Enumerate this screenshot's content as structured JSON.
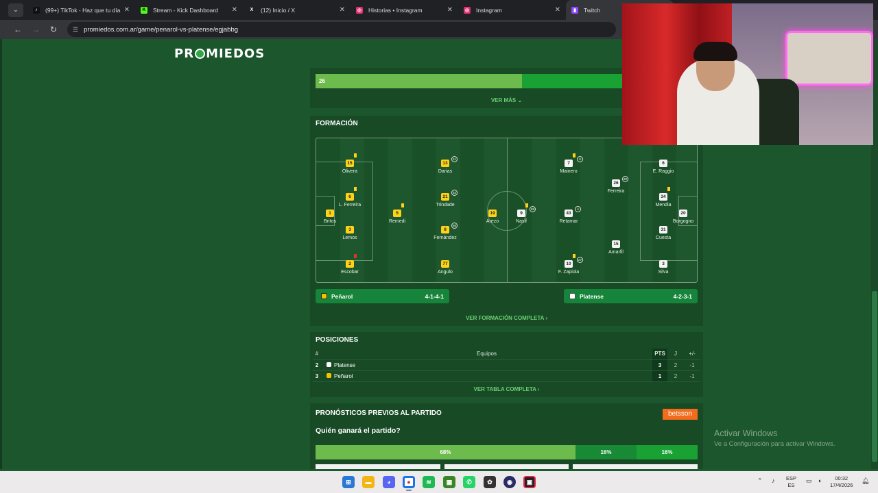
{
  "browser": {
    "tabs": [
      {
        "label": "(99+) TikTok - Haz que tu día sea",
        "icon": "tiktok-icon",
        "color": "#111111"
      },
      {
        "label": "Stream - Kick Dashboard",
        "icon": "kick-icon",
        "color": "#53fc18"
      },
      {
        "label": "(12) Inicio / X",
        "icon": "x-icon",
        "color": "#000000"
      },
      {
        "label": "Historias • Instagram",
        "icon": "instagram-icon",
        "color": "#e1306c"
      },
      {
        "label": "Instagram",
        "icon": "instagram-icon",
        "color": "#e1306c"
      },
      {
        "label": "Twitch",
        "icon": "twitch-icon",
        "color": "#9146ff"
      }
    ],
    "url": "promiedos.com.ar/game/penarol-vs-platense/egjabbg"
  },
  "site": {
    "logo_left": "PR",
    "logo_right": "MIEDOS"
  },
  "stats": {
    "bar_value": "26",
    "bar_fraction": 0.54,
    "ver_mas": "VER MÁS ⌄"
  },
  "formacion": {
    "title": "FORMACIÓN",
    "players": [
      {
        "num": "15",
        "name": "Olivera",
        "team": "home",
        "x": "",
        "card": "yellow"
      },
      {
        "num": "6",
        "name": "L. Ferreira",
        "team": "home",
        "card": "yellow"
      },
      {
        "num": "1",
        "name": "Britos",
        "team": "home"
      },
      {
        "num": "3",
        "name": "Lemos",
        "team": "home"
      },
      {
        "num": "2",
        "name": "Escobar",
        "team": "home",
        "card": "red"
      },
      {
        "num": "5",
        "name": "Remedi",
        "team": "home",
        "card": "yellow"
      },
      {
        "num": "13",
        "name": "Darias",
        "team": "home",
        "sub": "11"
      },
      {
        "num": "21",
        "name": "Trindade",
        "team": "home",
        "sub": "32"
      },
      {
        "num": "8",
        "name": "Fernández",
        "team": "home",
        "sub": "88"
      },
      {
        "num": "77",
        "name": "Angulo",
        "team": "home"
      },
      {
        "num": "19",
        "name": "Arezo",
        "team": "home"
      },
      {
        "num": "9",
        "name": "Nasif",
        "team": "away",
        "card": "yellow",
        "sub": "99"
      },
      {
        "num": "7",
        "name": "Mainero",
        "team": "away",
        "card": "yellow",
        "sub": "8"
      },
      {
        "num": "43",
        "name": "Retamar",
        "team": "away",
        "sub": "4"
      },
      {
        "num": "10",
        "name": "F. Zapiola",
        "team": "away",
        "card": "yellow",
        "sub": "27"
      },
      {
        "num": "26",
        "name": "Ferreira",
        "team": "away",
        "sub": "38"
      },
      {
        "num": "15",
        "name": "Amarfil",
        "team": "away"
      },
      {
        "num": "6",
        "name": "E. Raggio",
        "team": "away"
      },
      {
        "num": "34",
        "name": "Mendia",
        "team": "away",
        "card": "yellow"
      },
      {
        "num": "20",
        "name": "Borgogno",
        "team": "away"
      },
      {
        "num": "31",
        "name": "Cuesta",
        "team": "away"
      },
      {
        "num": "3",
        "name": "Silva",
        "team": "away"
      }
    ],
    "home": {
      "name": "Peñarol",
      "formation": "4-1-4-1"
    },
    "away": {
      "name": "Platense",
      "formation": "4-2-3-1"
    },
    "link": "VER FORMACIÓN COMPLETA ›"
  },
  "posiciones": {
    "title": "POSICIONES",
    "headers": {
      "pos": "#",
      "team": "Equipos",
      "pts": "PTS",
      "j": "J",
      "diff": "+/-"
    },
    "rows": [
      {
        "pos": "2",
        "team": "Platense",
        "pts": "3",
        "j": "2",
        "diff": "-1"
      },
      {
        "pos": "3",
        "team": "Peñarol",
        "pts": "1",
        "j": "2",
        "diff": "-1"
      }
    ],
    "link": "VER TABLA COMPLETA ›"
  },
  "pronosticos": {
    "title": "PRONÓSTICOS PREVIOS AL PARTIDO",
    "question": "Quién ganará el partido?",
    "sponsor": "betsson",
    "bars": [
      {
        "label": "68%",
        "value": 68,
        "color": "#6cbb4c"
      },
      {
        "label": "16%",
        "value": 16,
        "color": "#188a36"
      },
      {
        "label": "16%",
        "value": 16,
        "color": "#1aa133"
      }
    ]
  },
  "windows": {
    "line1": "Activar Windows",
    "line2": "Ve a Configuración para activar Windows."
  },
  "taskbar": {
    "lang1": "ESP",
    "lang2": "ES",
    "time": "00:32",
    "date": "17/4/2026"
  }
}
